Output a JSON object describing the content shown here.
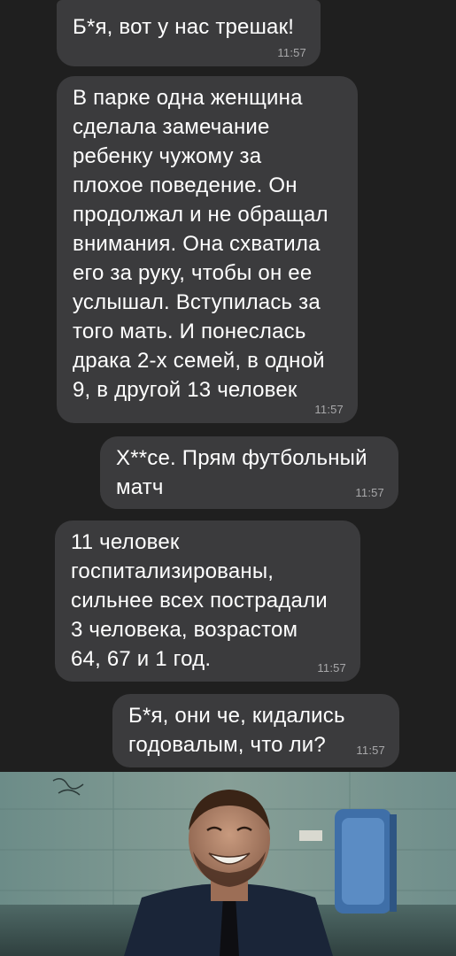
{
  "messages": [
    {
      "text": "Б*я, вот у нас трешак!",
      "time": "11:57"
    },
    {
      "text": "В парке одна женщина\nсделала замечание\nребенку чужому за\nплохое поведение. Он\nпродолжал и не обращал\nвнимания. Она схватила\nего за руку, чтобы он ее\nуслышал. Вступилась за\nтого мать. И понеслась\nдрака 2-х семей, в одной\n9, в другой 13 человек",
      "time": "11:57"
    },
    {
      "text": "Х**се. Прям футбольный\nматч",
      "time": "11:57"
    },
    {
      "text": "11 человек\nгоспитализированы,\nсильнее всех пострадали\n3 человека, возрастом\n64, 67 и 1 год.",
      "time": "11:57"
    },
    {
      "text": "Б*я, они че, кидались\nгодовалым, что ли?",
      "time": "11:57"
    }
  ],
  "colors": {
    "background": "#1f1f1f",
    "bubble": "#3b3b3d",
    "text": "#ffffff",
    "time": "#a8a8aa"
  },
  "photo": {
    "description_icon": "laughing-man-photo"
  }
}
